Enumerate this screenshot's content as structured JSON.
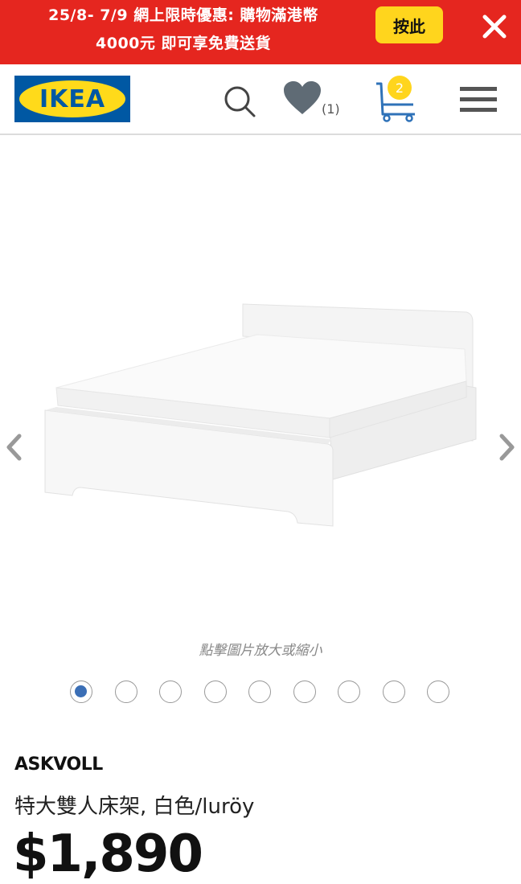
{
  "promo": {
    "line1": "25/8- 7/9 網上限時優惠: 購物滿港幣",
    "line2": "4000元 即可享免費送貨",
    "button_label": "按此",
    "close_icon": "close-icon",
    "background_color": "#e5261f",
    "button_color": "#ffd51d"
  },
  "header": {
    "logo_text": "IKEA",
    "search_icon": "search-icon",
    "wishlist_icon": "heart-icon",
    "wishlist_count": "(1)",
    "cart_icon": "shopping-cart-icon",
    "cart_count": "2",
    "menu_icon": "hamburger-menu-icon"
  },
  "gallery": {
    "prev_icon": "chevron-left-icon",
    "next_icon": "chevron-right-icon",
    "image_subject": "bed",
    "zoom_hint": "點擊圖片放大或縮小",
    "dots_total": 9,
    "active_dot": 1
  },
  "product": {
    "name": "ASKVOLL",
    "description": "特大雙人床架, 白色/luröy",
    "price": "$1,890"
  }
}
